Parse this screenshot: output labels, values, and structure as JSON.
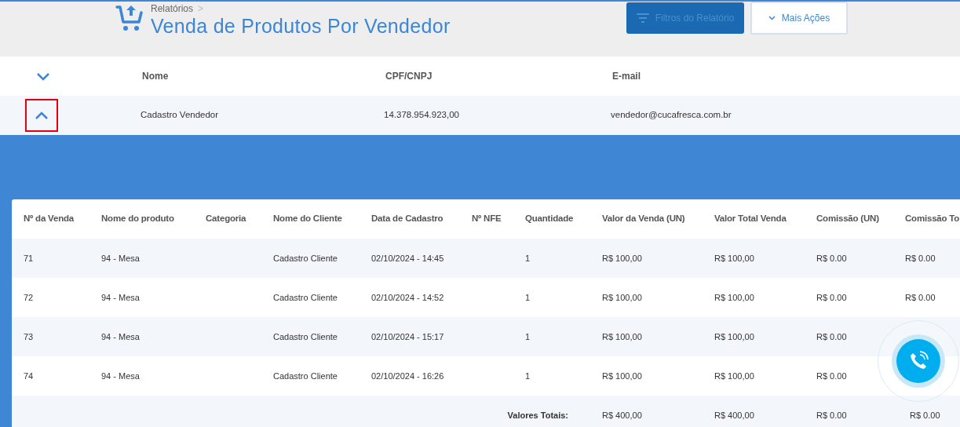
{
  "header": {
    "breadcrumb": "Relatórios",
    "breadcrumb_separator": ">",
    "title": "Venda de Produtos Por Vendedor",
    "buttons": [
      {
        "kind": "primary",
        "label": "Filtros do Relatório",
        "disabled": true
      },
      {
        "kind": "outline",
        "label": "Mais Ações",
        "disabled": false
      }
    ]
  },
  "seller_table": {
    "columns": [
      "Nome",
      "CPF/CNPJ",
      "E-mail"
    ],
    "header_expanded": false,
    "rows": [
      {
        "expanded": true,
        "highlighted": true,
        "cells": [
          "Cadastro Vendedor",
          "14.378.954.923,00",
          "vendedor@cucafresca.com.br"
        ]
      }
    ]
  },
  "sales_table": {
    "columns": [
      "Nº da Venda",
      "Nome do produto",
      "Categoria",
      "Nome do Cliente",
      "Data de Cadastro",
      "Nº NFE",
      "Quantidade",
      "Valor da Venda (UN)",
      "Valor Total Venda",
      "Comissão (UN)",
      "Comissão To"
    ],
    "rows": [
      {
        "cells": [
          "71",
          "94 - Mesa",
          "",
          "Cadastro Cliente",
          "02/10/2024 - 14:45",
          "",
          "1",
          "R$ 100,00",
          "R$ 100,00",
          "R$ 0.00",
          "R$ 0.00"
        ]
      },
      {
        "cells": [
          "72",
          "94 - Mesa",
          "",
          "Cadastro Cliente",
          "02/10/2024 - 14:52",
          "",
          "1",
          "R$ 100,00",
          "R$ 100,00",
          "R$ 0.00",
          "R$ 0.00"
        ]
      },
      {
        "cells": [
          "73",
          "94 - Mesa",
          "",
          "Cadastro Cliente",
          "02/10/2024 - 15:17",
          "",
          "1",
          "R$ 100,00",
          "R$ 100,00",
          "R$ 0.00",
          ""
        ]
      },
      {
        "cells": [
          "74",
          "94 - Mesa",
          "",
          "Cadastro Cliente",
          "02/10/2024 - 16:26",
          "",
          "1",
          "R$ 100,00",
          "R$ 100,00",
          "R$ 0.00",
          ""
        ]
      }
    ],
    "totals": {
      "label": "Valores Totais:",
      "values": [
        "R$ 400,00",
        "R$ 400,00",
        "R$ 0.00",
        "R$ 0.00"
      ]
    }
  }
}
